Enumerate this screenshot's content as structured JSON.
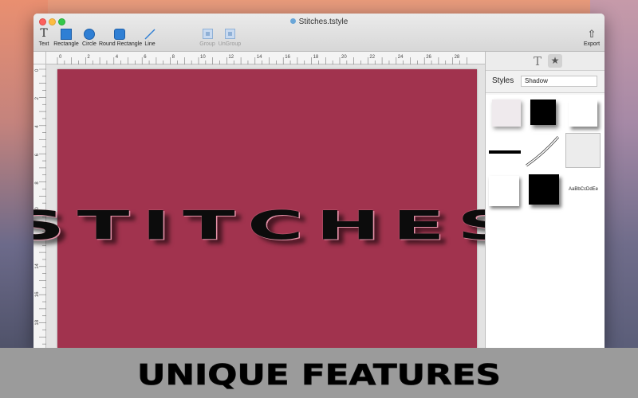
{
  "window": {
    "title": "Stitches.tstyle"
  },
  "toolbar": {
    "tools": [
      {
        "id": "text",
        "label": "Text",
        "icon": "text-tool-icon"
      },
      {
        "id": "rectangle",
        "label": "Rectangle",
        "icon": "rectangle-tool-icon"
      },
      {
        "id": "circle",
        "label": "Circle",
        "icon": "circle-tool-icon"
      },
      {
        "id": "round_rectangle",
        "label": "Round Rectangle",
        "icon": "round-rectangle-tool-icon"
      },
      {
        "id": "line",
        "label": "Line",
        "icon": "line-tool-icon"
      },
      {
        "id": "group",
        "label": "Group",
        "icon": "group-icon",
        "enabled": false
      },
      {
        "id": "ungroup",
        "label": "UnGroup",
        "icon": "ungroup-icon",
        "enabled": false
      },
      {
        "id": "export",
        "label": "Export",
        "icon": "share-icon"
      }
    ]
  },
  "rulers": {
    "top_labels": [
      "0",
      "2",
      "4",
      "6",
      "8",
      "10",
      "12",
      "14",
      "16",
      "18",
      "20",
      "22",
      "24",
      "26",
      "28"
    ],
    "left_labels": [
      "0",
      "2",
      "4",
      "6",
      "8",
      "10",
      "12",
      "14",
      "16",
      "18"
    ]
  },
  "canvas": {
    "background_color": "#a1334e",
    "text": "STITCHES",
    "text_color": "#0c0c0c"
  },
  "sidebar": {
    "tabs": [
      {
        "label": "T",
        "icon": "text-style-tab-icon"
      },
      {
        "label": "★",
        "icon": "star-icon",
        "selected": true
      }
    ],
    "styles_label": "Styles",
    "styles_selected": "Shadow",
    "preview_text": "AaBbCcDdEe"
  },
  "banner": {
    "text": "UNIQUE FEATURES"
  },
  "colors": {
    "accent": "#2f7fd4",
    "banner_bg": "#9b9b9b",
    "banner_text": "#000000"
  }
}
